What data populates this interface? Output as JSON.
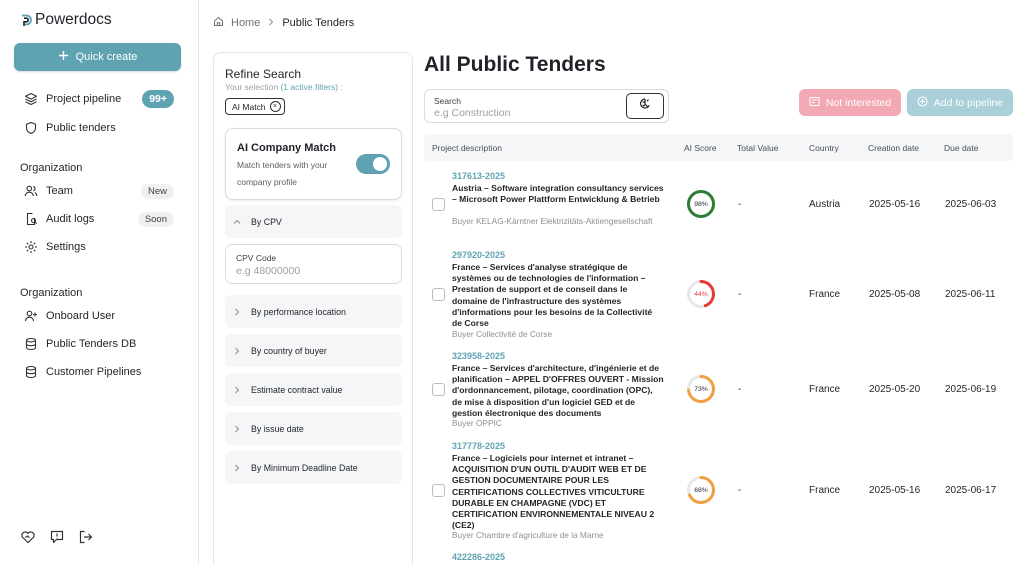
{
  "brand": {
    "name": "Powerdocs"
  },
  "sidebar": {
    "quick_create": "Quick create",
    "items": [
      {
        "label": "Project pipeline",
        "badge": "99+"
      },
      {
        "label": "Public tenders"
      }
    ],
    "org1": {
      "title": "Organization",
      "items": [
        {
          "label": "Team",
          "badge": "New"
        },
        {
          "label": "Audit logs",
          "badge": "Soon"
        },
        {
          "label": "Settings"
        }
      ]
    },
    "org2": {
      "title": "Organization",
      "items": [
        {
          "label": "Onboard User"
        },
        {
          "label": "Public Tenders DB"
        },
        {
          "label": "Customer Pipelines"
        }
      ]
    }
  },
  "breadcrumb": {
    "home": "Home",
    "current": "Public Tenders"
  },
  "filters": {
    "title": "Refine Search",
    "selection_prefix": "Your selection",
    "selection_count": "(1 active filters)",
    "selection_suffix": ":",
    "chip": "AI Match",
    "chip_close": "×",
    "ai_title": "AI Company Match",
    "ai_desc": "Match tenders with your company profile",
    "by_cpv": "By CPV",
    "cpv_label": "CPV Code",
    "cpv_placeholder": "e.g 48000000",
    "sections": [
      "By performance location",
      "By country of buyer",
      "Estimate contract value",
      "By issue date",
      "By Minimum Deadline Date"
    ]
  },
  "main": {
    "title": "All Public Tenders",
    "search_label": "Search",
    "search_placeholder": "e.g Construction",
    "not_interested": "Not interested",
    "add_pipeline": "Add to pipeline",
    "columns": {
      "desc": "Project description",
      "score": "AI Score",
      "value": "Total Value",
      "country": "Country",
      "created": "Creation date",
      "due": "Due date"
    }
  },
  "colors": {
    "accent": "#5fa3b3",
    "green": "#2e7d32",
    "red": "#e53935",
    "orange": "#f0a040",
    "pink": "#f2a9b4"
  },
  "rows": [
    {
      "id": "317613-2025",
      "title": "Austria – Software integration consultancy services – Microsoft Power Plattform Entwicklung & Betrieb",
      "buyer": "Buyer KELAG-Kärntner Elektrizitäts-Aktiengesellschaft",
      "score": "98%",
      "score_value": 98,
      "score_color": "#2e7d32",
      "value": "-",
      "country": "Austria",
      "created": "2025-05-16",
      "due": "2025-06-03"
    },
    {
      "id": "297920-2025",
      "title": "France – Services d'analyse stratégique de systèmes ou de technologies de l'information – Prestation de support et de conseil dans le domaine de l'infrastructure des systèmes d'informations pour les besoins de la Collectivité de Corse",
      "buyer": "Buyer Collectivité de Corse",
      "score": "44%",
      "score_value": 44,
      "score_color": "#e53935",
      "value": "-",
      "country": "France",
      "created": "2025-05-08",
      "due": "2025-06-11"
    },
    {
      "id": "323958-2025",
      "title": "France – Services d'architecture, d'ingénierie et de planification – APPEL D'OFFRES OUVERT - Mission d'ordonnancement, pilotage, coordination (OPC), de mise à disposition d'un logiciel GED et de gestion électronique des documents",
      "buyer": "Buyer OPPIC",
      "score": "73%",
      "score_value": 73,
      "score_color": "#f0a040",
      "value": "-",
      "country": "France",
      "created": "2025-05-20",
      "due": "2025-06-19"
    },
    {
      "id": "317778-2025",
      "title": "France – Logiciels pour internet et intranet – ACQUISITION D'UN OUTIL D'AUDIT WEB ET DE GESTION DOCUMENTAIRE POUR LES CERTIFICATIONS COLLECTIVES VITICULTURE DURABLE EN CHAMPAGNE (VDC) ET CERTIFICATION ENVIRONNEMENTALE NIVEAU 2 (CE2)",
      "buyer": "Buyer Chambre d'agriculture de la Marne",
      "score": "68%",
      "score_value": 68,
      "score_color": "#f0a040",
      "value": "-",
      "country": "France",
      "created": "2025-05-16",
      "due": "2025-06-17"
    },
    {
      "id": "422286-2025"
    }
  ]
}
